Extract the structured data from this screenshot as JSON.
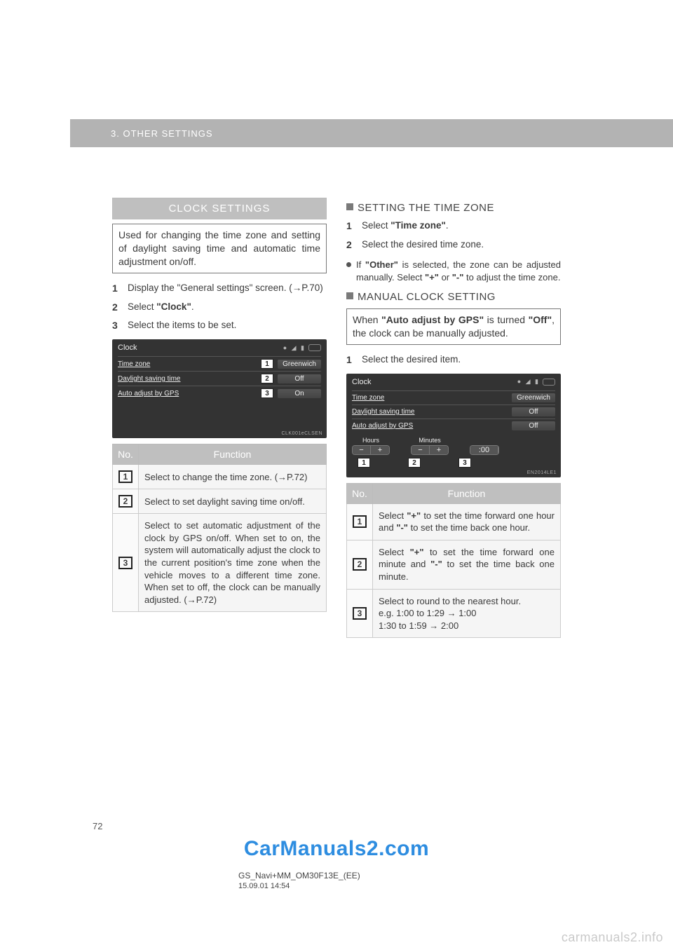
{
  "header": {
    "breadcrumb": "3. OTHER SETTINGS"
  },
  "left": {
    "section_title": "CLOCK SETTINGS",
    "intro": "Used for changing the time zone and setting of daylight saving time and automatic time adjustment on/off.",
    "steps": {
      "s1": "Display the \"General settings\" screen. (→P.70)",
      "s2_prefix": "Select ",
      "s2_bold": "\"Clock\"",
      "s2_suffix": ".",
      "s3": "Select the items to be set."
    },
    "screenshot": {
      "title": "Clock",
      "rows": [
        {
          "label": "Time zone",
          "callout": "1",
          "value": "Greenwich"
        },
        {
          "label": "Daylight saving time",
          "callout": "2",
          "value": "Off"
        },
        {
          "label": "Auto adjust by GPS",
          "callout": "3",
          "value": "On"
        }
      ],
      "code": "CLK001eCLSEN"
    },
    "table": {
      "head_no": "No.",
      "head_func": "Function",
      "rows": [
        {
          "n": "1",
          "text": "Select to change the time zone. (→P.72)"
        },
        {
          "n": "2",
          "text": "Select to set daylight saving time on/off."
        },
        {
          "n": "3",
          "text": "Select to set automatic adjustment of the clock by GPS on/off. When set to on, the system will automatically adjust the clock to the current position's time zone when the vehicle moves to a different time zone. When set to off, the clock can be manually adjusted. (→P.72)"
        }
      ]
    }
  },
  "right": {
    "tz_heading": "SETTING THE TIME ZONE",
    "tz_steps": {
      "s1_prefix": "Select ",
      "s1_bold": "\"Time zone\"",
      "s1_suffix": ".",
      "s2": "Select the desired time zone."
    },
    "tz_note_parts": {
      "p1": "If ",
      "b1": "\"Other\"",
      "p2": " is selected, the zone can be adjusted manually. Select ",
      "b2": "\"+\"",
      "p3": " or ",
      "b3": "\"-\"",
      "p4": " to adjust the time zone."
    },
    "manual_heading": "MANUAL CLOCK SETTING",
    "manual_box_parts": {
      "p1": "When ",
      "b1": "\"Auto adjust by GPS\"",
      "p2": " is turned ",
      "b2": "\"Off\"",
      "p3": ", the clock can be manually adjusted."
    },
    "manual_step": "Select the desired item.",
    "screenshot": {
      "title": "Clock",
      "rows": [
        {
          "label": "Time zone",
          "value": "Greenwich"
        },
        {
          "label": "Daylight saving time",
          "value": "Off"
        },
        {
          "label": "Auto adjust by GPS",
          "value": "Off"
        }
      ],
      "adjust": {
        "hours_label": "Hours",
        "minutes_label": "Minutes",
        "round": ":00"
      },
      "callouts": [
        "1",
        "2",
        "3"
      ],
      "code": "EN2014LE1"
    },
    "table": {
      "head_no": "No.",
      "head_func": "Function",
      "rows": [
        {
          "n": "1",
          "parts": {
            "p1": "Select ",
            "b1": "\"+\"",
            "p2": " to set the time forward one hour and ",
            "b2": "\"-\"",
            "p3": " to set the time back one hour."
          }
        },
        {
          "n": "2",
          "parts": {
            "p1": "Select ",
            "b1": "\"+\"",
            "p2": " to set the time forward one minute and ",
            "b2": "\"-\"",
            "p3": " to set the time back one minute."
          }
        },
        {
          "n": "3",
          "text": "Select to round to the nearest hour.\ne.g. 1:00 to 1:29 → 1:00\n       1:30 to 1:59 → 2:00"
        }
      ]
    }
  },
  "footer": {
    "page": "72",
    "watermark": "CarManuals2.com",
    "doc_id": "GS_Navi+MM_OM30F13E_(EE)",
    "doc_date": "15.09.01   14:54",
    "corner": "carmanuals2.info"
  }
}
